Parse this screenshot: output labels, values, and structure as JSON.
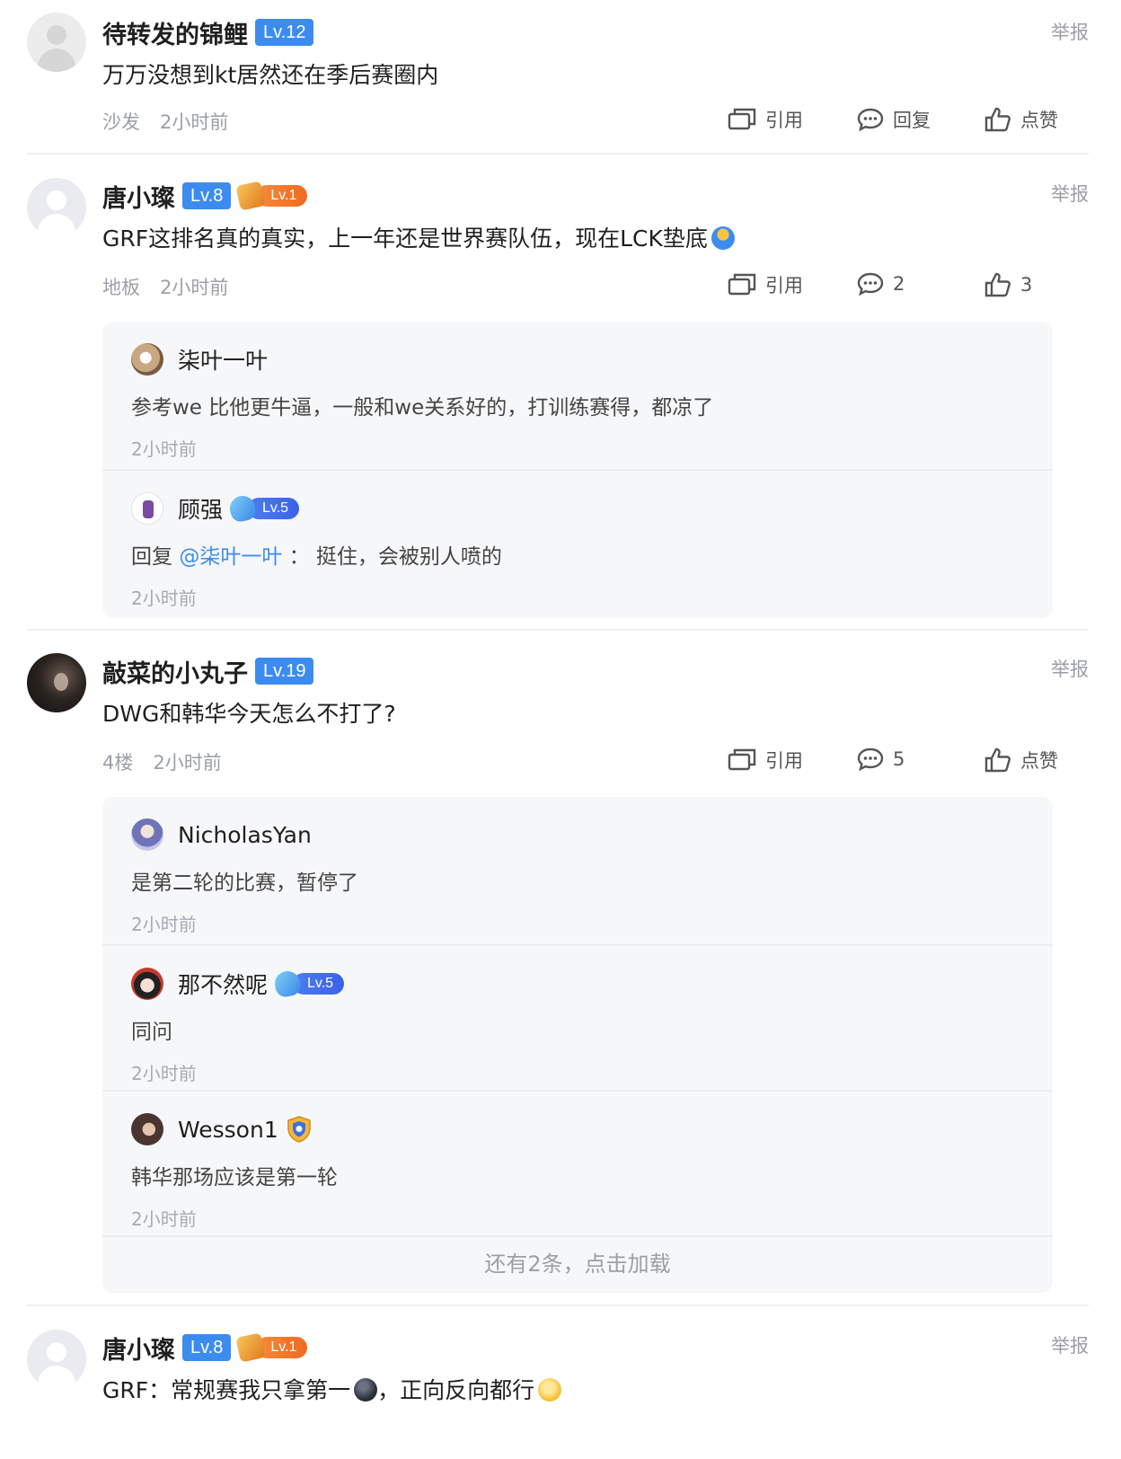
{
  "common": {
    "report_label": "举报",
    "quote_label": "引用",
    "reply_label": "回复",
    "like_label": "点赞"
  },
  "posts": [
    {
      "username": "待转发的锦鲤",
      "level": "Lv.12",
      "content": "万万没想到kt居然还在季后赛圈内",
      "floor": "沙发",
      "time": "2小时前",
      "comments_label": "回复",
      "likes_label": "点赞"
    },
    {
      "username": "唐小璨",
      "level": "Lv.8",
      "game_level": "Lv.1",
      "content": "GRF这排名真的真实，上一年还是世界赛队伍，现在LCK垫底",
      "floor": "地板",
      "time": "2小时前",
      "comments_label": "2",
      "likes_label": "3",
      "replies": [
        {
          "username": "柒叶一叶",
          "text": "参考we 比他更牛逼，一般和we关系好的，打训练赛得，都凉了",
          "time": "2小时前"
        },
        {
          "username": "顾强",
          "game_level": "Lv.5",
          "reply_prefix": "回复",
          "mention": "@柒叶一叶",
          "text": "： 挺住，会被别人喷的",
          "time": "2小时前"
        }
      ]
    },
    {
      "username": "敲菜的小丸子",
      "level": "Lv.19",
      "content": "DWG和韩华今天怎么不打了?",
      "floor": "4楼",
      "time": "2小时前",
      "comments_label": "5",
      "likes_label": "点赞",
      "replies": [
        {
          "username": "NicholasYan",
          "text": "是第二轮的比赛，暂停了",
          "time": "2小时前"
        },
        {
          "username": "那不然呢",
          "game_level": "Lv.5",
          "text": "同问",
          "time": "2小时前"
        },
        {
          "username": "Wesson1",
          "text": "韩华那场应该是第一轮",
          "time": "2小时前"
        }
      ],
      "load_more": "还有2条，点击加载"
    },
    {
      "username": "唐小璨",
      "level": "Lv.8",
      "game_level": "Lv.1",
      "content": "GRF：常规赛我只拿第一",
      "content_suffix": "，正向反向都行"
    }
  ],
  "icons": [
    "quote-icon",
    "comment-icon",
    "thumbs-up-icon",
    "shrug-emoji-icon",
    "dark-face-emoji-icon",
    "smile-emoji-icon",
    "shield-icon"
  ],
  "colors": {
    "level_badge": "#3c8cf0",
    "mention": "#3c8cf0",
    "muted": "#9aa0a8",
    "reply_bg": "#f6f7f9",
    "game_badge": "#f06a20"
  }
}
